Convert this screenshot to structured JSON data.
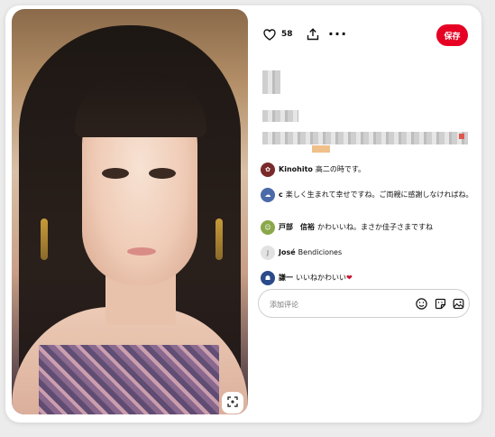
{
  "pin": {
    "save_label": "保存",
    "like_count": "58",
    "icons": {
      "like": "heart-outline-icon",
      "share": "share-upload-icon",
      "more": "more-dots-icon",
      "lens": "visual-search-icon"
    }
  },
  "comments": [
    {
      "author": "Kinohito",
      "text": "高二の時です。",
      "avatar_color": "#7a2a2a"
    },
    {
      "author": "c",
      "text": "楽しく生まれて幸せですね。ご両親に感謝しなければね。",
      "avatar_color": "#4b6aa8"
    },
    {
      "author": "戸部　信裕",
      "text": "かわいいね。まさか佳子さまですね",
      "avatar_color": "#8aa84b"
    },
    {
      "author": "José",
      "text": "Bendiciones",
      "avatar_color": "#d8d8d8",
      "avatar_letter": "J"
    },
    {
      "author": "謙一",
      "text": "いいねかわいい",
      "emoji": "❤",
      "avatar_color": "#2a4a8a"
    }
  ],
  "comment_input": {
    "placeholder": "添加评论",
    "icons": [
      "emoji-icon",
      "sticker-icon",
      "image-icon"
    ]
  },
  "colors": {
    "accent": "#e60023"
  }
}
